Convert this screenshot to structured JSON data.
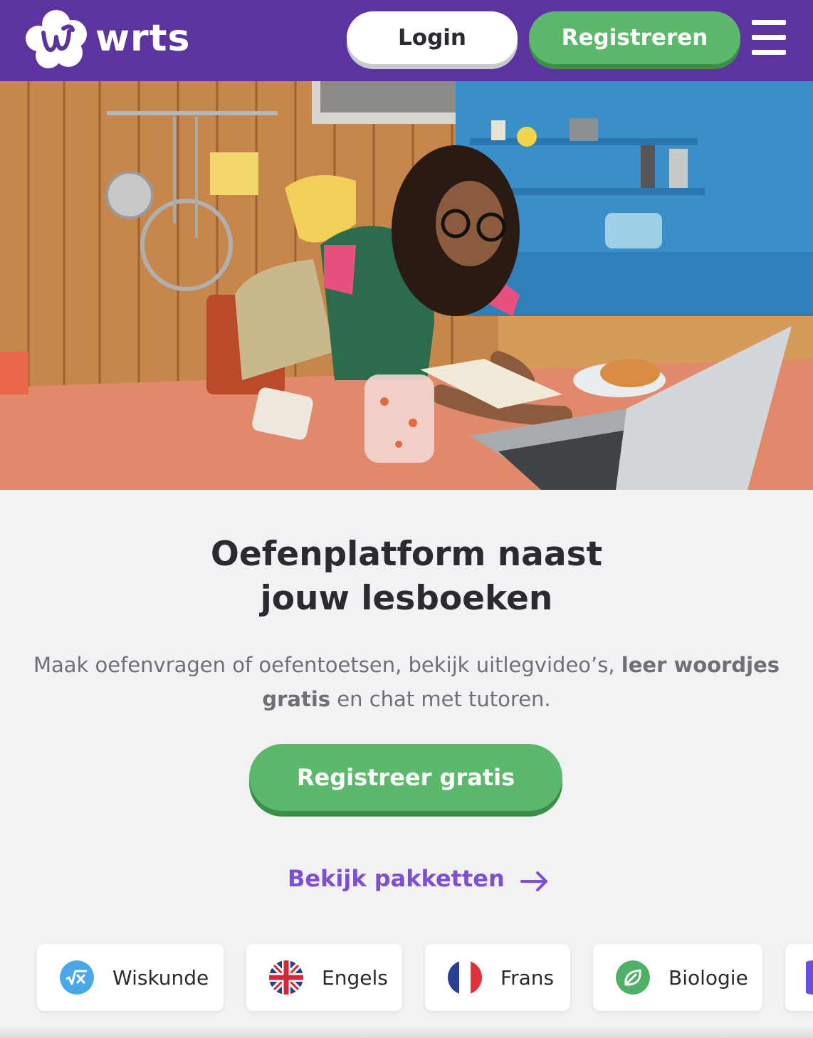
{
  "header": {
    "logo_text": "wrts",
    "login_label": "Login",
    "register_label": "Registreren",
    "menu_icon": "hamburger-icon"
  },
  "hero": {
    "image": "student-studying-laptop-kitchen"
  },
  "main": {
    "headline_line1": "Oefenplatform naast",
    "headline_line2": "jouw lesboeken",
    "subtitle_part1": "Maak oefenvragen of oefentoetsen, bekijk uitlegvideo’s,",
    "subtitle_bold": "leer woordjes gratis",
    "subtitle_part2": "en chat met tutoren.",
    "cta_label": "Registreer gratis",
    "packages_link": "Bekijk pakketten"
  },
  "subjects": [
    {
      "label": "Wiskunde",
      "icon": "math-sqrt-icon"
    },
    {
      "label": "Engels",
      "icon": "uk-flag-icon"
    },
    {
      "label": "Frans",
      "icon": "france-flag-icon"
    },
    {
      "label": "Biologie",
      "icon": "leaf-icon"
    }
  ],
  "colors": {
    "brand_purple": "#5c34a0",
    "green": "#5cb86a",
    "link_purple": "#7d4fd1",
    "background": "#f2f2f4"
  }
}
